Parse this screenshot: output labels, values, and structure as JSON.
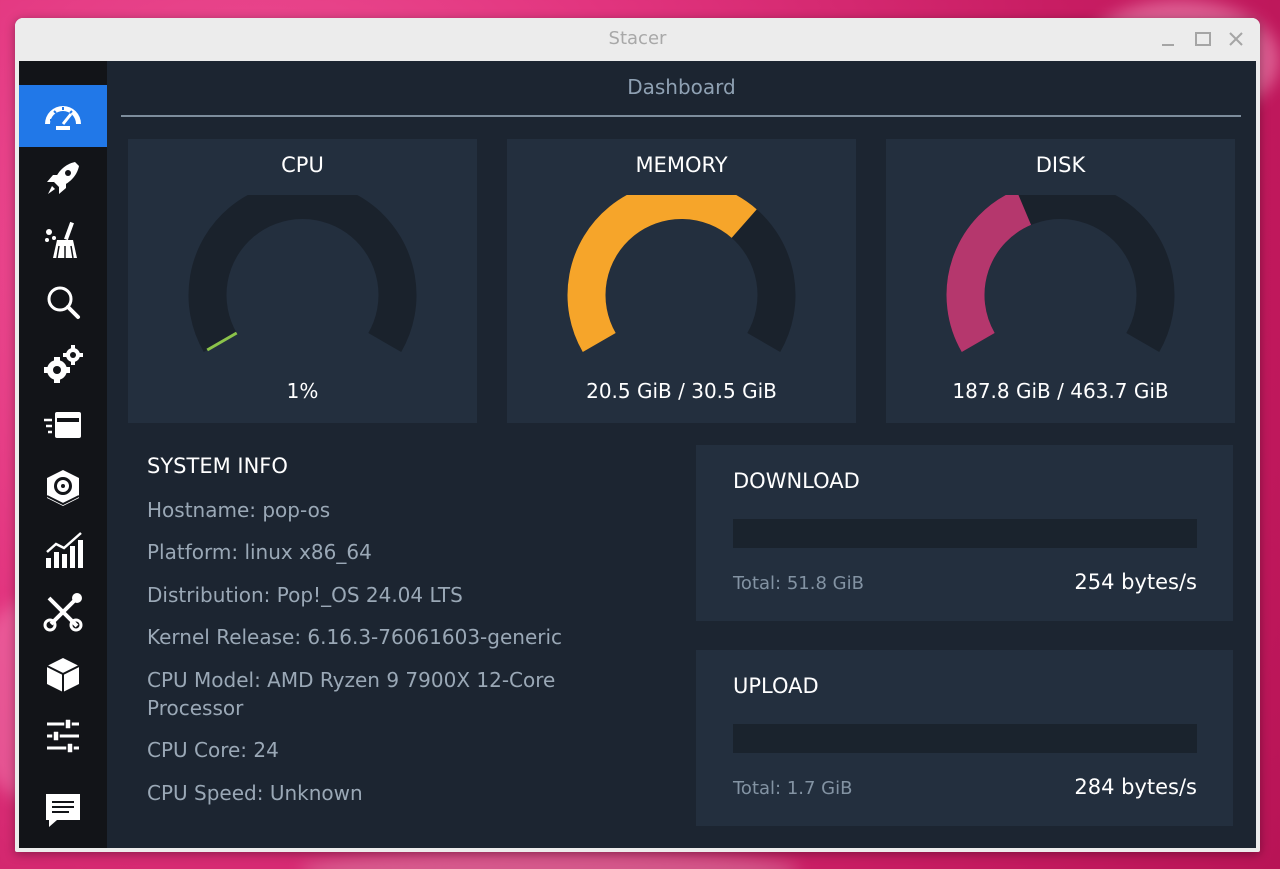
{
  "window": {
    "title": "Stacer",
    "controls": [
      "minimize",
      "maximize",
      "close"
    ]
  },
  "sidebar": {
    "items": [
      {
        "name": "dashboard",
        "icon": "speedometer-icon",
        "active": true
      },
      {
        "name": "startup-apps",
        "icon": "rocket-icon",
        "active": false
      },
      {
        "name": "system-cleaner",
        "icon": "broom-icon",
        "active": false
      },
      {
        "name": "search",
        "icon": "magnifier-icon",
        "active": false
      },
      {
        "name": "services",
        "icon": "gears-icon",
        "active": false
      },
      {
        "name": "processes",
        "icon": "stack-icon",
        "active": false
      },
      {
        "name": "uninstaller",
        "icon": "disk-box-icon",
        "active": false
      },
      {
        "name": "resources",
        "icon": "bar-chart-icon",
        "active": false
      },
      {
        "name": "helpers",
        "icon": "tools-icon",
        "active": false
      },
      {
        "name": "apt-repository",
        "icon": "package-icon",
        "active": false
      },
      {
        "name": "settings",
        "icon": "sliders-icon",
        "active": false
      },
      {
        "name": "feedback",
        "icon": "chat-icon",
        "active": false
      }
    ],
    "active_color": "#2178e8"
  },
  "dashboard": {
    "title": "Dashboard",
    "gauges": {
      "cpu": {
        "label": "CPU",
        "value": "1%",
        "fraction": 0.01,
        "color": "#8bc34a"
      },
      "memory": {
        "label": "MEMORY",
        "value": "20.5 GiB / 30.5 GiB",
        "fraction": 0.672,
        "color": "#f6a52a"
      },
      "disk": {
        "label": "DISK",
        "value": "187.8 GiB / 463.7 GiB",
        "fraction": 0.405,
        "color": "#b5376d"
      }
    },
    "system_info": {
      "title": "SYSTEM INFO",
      "hostname": "Hostname: pop-os",
      "platform": "Platform: linux x86_64",
      "distribution": "Distribution: Pop!_OS 24.04 LTS",
      "kernel": "Kernel Release: 6.16.3-76061603-generic",
      "cpu_model": "CPU Model:  AMD Ryzen 9 7900X 12-Core Processor",
      "cpu_core": "CPU Core: 24",
      "cpu_speed": "CPU Speed: Unknown"
    },
    "download": {
      "title": "DOWNLOAD",
      "total": "Total: 51.8 GiB",
      "rate": "254 bytes/s",
      "fraction": 0
    },
    "upload": {
      "title": "UPLOAD",
      "total": "Total: 1.7 GiB",
      "rate": "284 bytes/s",
      "fraction": 0
    }
  },
  "colors": {
    "app_bg": "#1c2531",
    "card_bg": "#232f3e",
    "sidebar_bg": "#121418",
    "gauge_track": "#1a222c"
  }
}
